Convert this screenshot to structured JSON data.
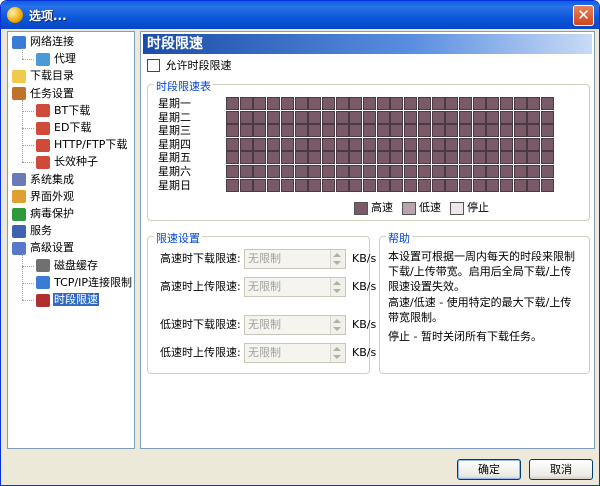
{
  "window": {
    "title": "选项...",
    "close_glyph": "✕"
  },
  "tree": {
    "items": [
      {
        "label": "网络连接",
        "icon": "globe-icon",
        "color": "#3a7bd5"
      },
      {
        "label": "代理",
        "icon": "proxy-icon",
        "color": "#4a9ad8"
      },
      {
        "label": "下载目录",
        "icon": "folder-icon",
        "color": "#f2c94c"
      },
      {
        "label": "任务设置",
        "icon": "task-icon",
        "color": "#c0712a"
      },
      {
        "label": "BT下载",
        "icon": "bt-icon",
        "color": "#d04a3a"
      },
      {
        "label": "ED下载",
        "icon": "ed-icon",
        "color": "#d04a3a"
      },
      {
        "label": "HTTP/FTP下载",
        "icon": "http-icon",
        "color": "#d04a3a"
      },
      {
        "label": "长效种子",
        "icon": "seed-icon",
        "color": "#d04a3a"
      },
      {
        "label": "系统集成",
        "icon": "system-icon",
        "color": "#6a7ab8"
      },
      {
        "label": "界面外观",
        "icon": "appearance-icon",
        "color": "#e0a030"
      },
      {
        "label": "病毒保护",
        "icon": "shield-icon",
        "color": "#2f9a3a"
      },
      {
        "label": "服务",
        "icon": "service-icon",
        "color": "#4060b0"
      },
      {
        "label": "高级设置",
        "icon": "advanced-icon",
        "color": "#5878c8"
      },
      {
        "label": "磁盘缓存",
        "icon": "disk-icon",
        "color": "#707070"
      },
      {
        "label": "TCP/IP连接限制",
        "icon": "network-icon",
        "color": "#3a7bd5"
      },
      {
        "label": "时段限速",
        "icon": "schedule-icon",
        "color": "#b03030"
      }
    ],
    "selected_index": 15
  },
  "page": {
    "title": "时段限速",
    "enable_label": "允许时段限速",
    "enable_checked": false
  },
  "schedule": {
    "group_title": "时段限速表",
    "days": [
      "星期一",
      "星期二",
      "星期三",
      "星期四",
      "星期五",
      "星期六",
      "星期日"
    ],
    "slots_per_day": 24,
    "fill_mode": "高速",
    "legend": [
      {
        "label": "高速",
        "color": "#7a5a69"
      },
      {
        "label": "低速",
        "color": "#b9a3ae"
      },
      {
        "label": "停止",
        "color": "#efe6ea"
      }
    ]
  },
  "limits": {
    "group_title": "限速设置",
    "rows": [
      {
        "label": "高速时下载限速:",
        "value": "",
        "placeholder": "无限制",
        "unit": "KB/s"
      },
      {
        "label": "高速时上传限速:",
        "value": "",
        "placeholder": "无限制",
        "unit": "KB/s"
      },
      {
        "label": "低速时下载限速:",
        "value": "",
        "placeholder": "无限制",
        "unit": "KB/s"
      },
      {
        "label": "低速时上传限速:",
        "value": "",
        "placeholder": "无限制",
        "unit": "KB/s"
      }
    ]
  },
  "help": {
    "group_title": "帮助",
    "paragraphs": [
      "本设置可根据一周内每天的时段来限制下载/上传带宽。启用后全局下载/上传限速设置失效。",
      "高速/低速 - 使用特定的最大下载/上传带宽限制。",
      "停止 - 暂时关闭所有下载任务。"
    ]
  },
  "buttons": {
    "ok": "确定",
    "cancel": "取消"
  }
}
